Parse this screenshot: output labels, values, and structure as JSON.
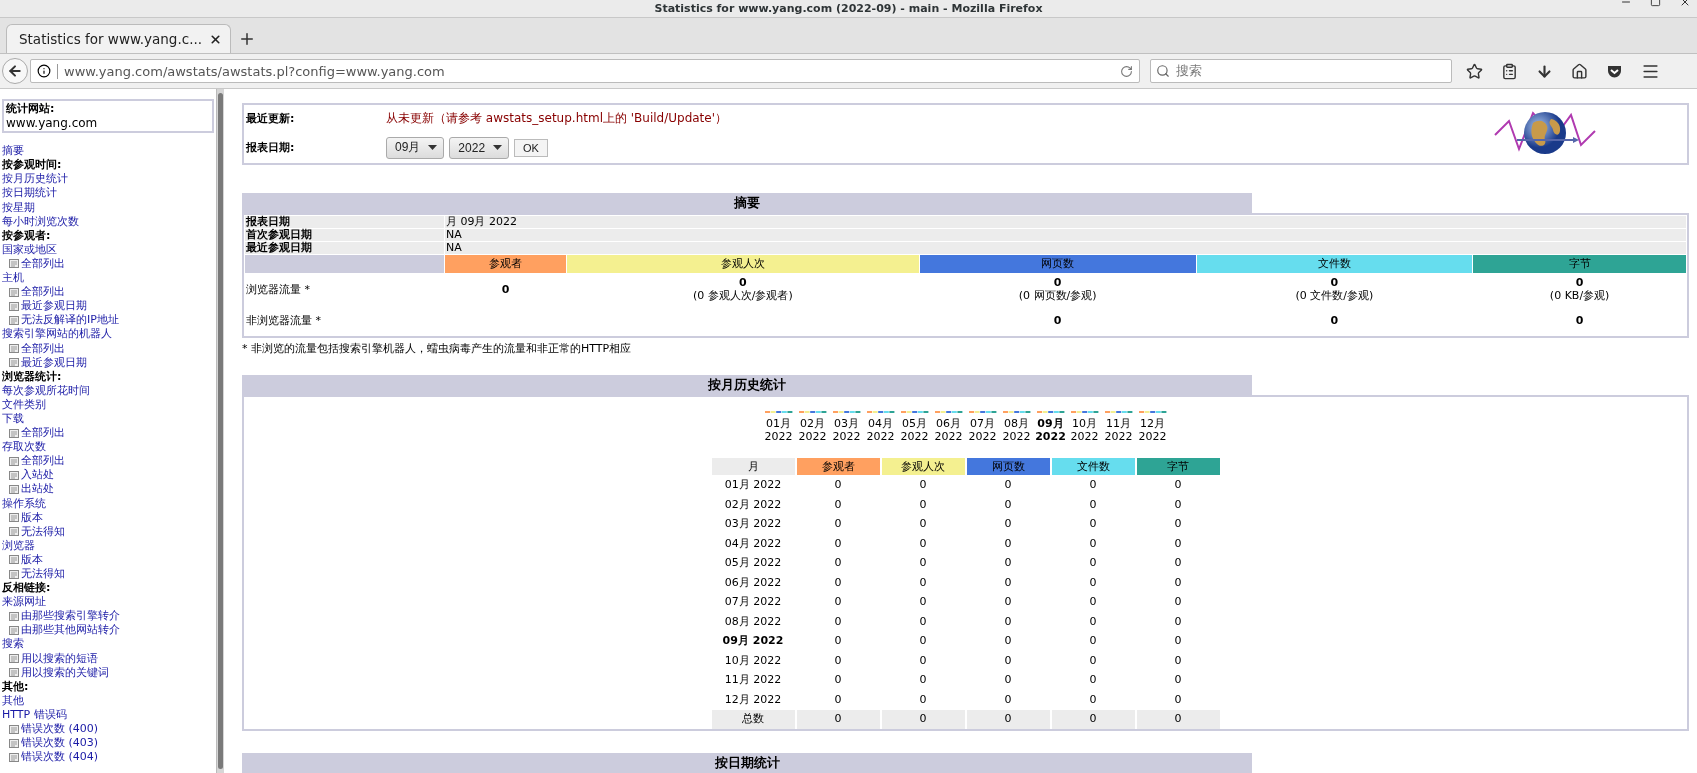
{
  "window": {
    "title": "Statistics for www.yang.com (2022-09) - main - Mozilla Firefox"
  },
  "tabs": [
    {
      "label": "Statistics for www.yang.c...",
      "selected": true
    }
  ],
  "address_bar": {
    "url": "www.yang.com/awstats/awstats.pl?config=www.yang.com"
  },
  "search": {
    "placeholder": "搜索"
  },
  "sidebar": {
    "site_label": "统计网站:",
    "site": "www.yang.com",
    "items": [
      {
        "kind": "link",
        "label": "摘要"
      },
      {
        "kind": "heading",
        "label": "按参观时间:"
      },
      {
        "kind": "link",
        "label": "按月历史统计"
      },
      {
        "kind": "link",
        "label": "按日期统计"
      },
      {
        "kind": "link",
        "label": "按星期"
      },
      {
        "kind": "link",
        "label": "每小时浏览次数"
      },
      {
        "kind": "heading",
        "label": "按参观者:"
      },
      {
        "kind": "link",
        "label": "国家或地区",
        "children": [
          {
            "label": "全部列出"
          }
        ]
      },
      {
        "kind": "link",
        "label": "主机",
        "children": [
          {
            "label": "全部列出"
          },
          {
            "label": "最近参观日期"
          },
          {
            "label": "无法反解译的IP地址"
          }
        ]
      },
      {
        "kind": "link",
        "label": "搜索引擎网站的机器人",
        "children": [
          {
            "label": "全部列出"
          },
          {
            "label": "最近参观日期"
          }
        ]
      },
      {
        "kind": "heading",
        "label": "浏览器统计:"
      },
      {
        "kind": "link",
        "label": "每次参观所花时间"
      },
      {
        "kind": "link",
        "label": "文件类别"
      },
      {
        "kind": "link",
        "label": "下载",
        "children": [
          {
            "label": "全部列出"
          }
        ]
      },
      {
        "kind": "link",
        "label": "存取次数",
        "children": [
          {
            "label": "全部列出"
          },
          {
            "label": "入站处"
          },
          {
            "label": "出站处"
          }
        ]
      },
      {
        "kind": "link",
        "label": "操作系统",
        "children": [
          {
            "label": "版本"
          },
          {
            "label": "无法得知"
          }
        ]
      },
      {
        "kind": "link",
        "label": "浏览器",
        "children": [
          {
            "label": "版本"
          },
          {
            "label": "无法得知"
          }
        ]
      },
      {
        "kind": "heading",
        "label": "反相链接:"
      },
      {
        "kind": "link",
        "label": "来源网址",
        "children": [
          {
            "label": "由那些搜索引擎转介"
          },
          {
            "label": "由那些其他网站转介"
          }
        ]
      },
      {
        "kind": "link",
        "label": "搜索",
        "children": [
          {
            "label": "用以搜索的短语"
          },
          {
            "label": "用以搜索的关键词"
          }
        ]
      },
      {
        "kind": "heading",
        "label": "其他:"
      },
      {
        "kind": "link",
        "label": "其他"
      },
      {
        "kind": "link",
        "label": "HTTP 错误码",
        "children": [
          {
            "label": "错误次数 (400)"
          },
          {
            "label": "错误次数 (403)"
          },
          {
            "label": "错误次数 (404)"
          }
        ]
      }
    ]
  },
  "header": {
    "update_label": "最近更新:",
    "update_text": "从未更新（请参考 awstats_setup.html上的 'Build/Update'）",
    "date_label": "报表日期:",
    "month": "09月",
    "year": "2022",
    "ok": "OK"
  },
  "summary": {
    "title": "摘要",
    "info_rows": [
      {
        "label": "报表日期",
        "value": "月 09月 2022"
      },
      {
        "label": "首次参观日期",
        "value": "NA"
      },
      {
        "label": "最近参观日期",
        "value": "NA"
      }
    ],
    "columns": [
      {
        "label": "参观者",
        "color": "#ffa060"
      },
      {
        "label": "参观人次",
        "color": "#f4f090"
      },
      {
        "label": "网页数",
        "color": "#4477dd"
      },
      {
        "label": "文件数",
        "color": "#66ddee"
      },
      {
        "label": "字节",
        "color": "#2ea495"
      }
    ],
    "traffic_rows": [
      {
        "label": "浏览器流量 *",
        "cells": [
          {
            "value": "0"
          },
          {
            "value": "0",
            "detail": "(0 参观人次/参观者)"
          },
          {
            "value": "0",
            "detail": "(0 网页数/参观)"
          },
          {
            "value": "0",
            "detail": "(0 文件数/参观)"
          },
          {
            "value": "0",
            "detail": "(0 KB/参观)"
          }
        ]
      },
      {
        "label": "非浏览器流量 *",
        "cells": [
          {
            "value": "0"
          },
          {
            "value": "0"
          },
          {
            "value": "0"
          }
        ]
      }
    ],
    "note": "* 非浏览的流量包括搜索引擎机器人，蠕虫病毒产生的流量和非正常的HTTP相应"
  },
  "monthly": {
    "title": "按月历史统计",
    "chart_months": [
      {
        "month": "01月",
        "year": "2022",
        "selected": false
      },
      {
        "month": "02月",
        "year": "2022",
        "selected": false
      },
      {
        "month": "03月",
        "year": "2022",
        "selected": false
      },
      {
        "month": "04月",
        "year": "2022",
        "selected": false
      },
      {
        "month": "05月",
        "year": "2022",
        "selected": false
      },
      {
        "month": "06月",
        "year": "2022",
        "selected": false
      },
      {
        "month": "07月",
        "year": "2022",
        "selected": false
      },
      {
        "month": "08月",
        "year": "2022",
        "selected": false
      },
      {
        "month": "09月",
        "year": "2022",
        "selected": true
      },
      {
        "month": "10月",
        "year": "2022",
        "selected": false
      },
      {
        "month": "11月",
        "year": "2022",
        "selected": false
      },
      {
        "month": "12月",
        "year": "2022",
        "selected": false
      }
    ],
    "month_header": "月",
    "columns": [
      {
        "label": "参观者",
        "color": "#ffa060"
      },
      {
        "label": "参观人次",
        "color": "#f4f090"
      },
      {
        "label": "网页数",
        "color": "#4477dd"
      },
      {
        "label": "文件数",
        "color": "#66ddee"
      },
      {
        "label": "字节",
        "color": "#2ea495"
      }
    ],
    "rows": [
      {
        "month": "01月 2022",
        "selected": false,
        "values": [
          "0",
          "0",
          "0",
          "0",
          "0"
        ]
      },
      {
        "month": "02月 2022",
        "selected": false,
        "values": [
          "0",
          "0",
          "0",
          "0",
          "0"
        ]
      },
      {
        "month": "03月 2022",
        "selected": false,
        "values": [
          "0",
          "0",
          "0",
          "0",
          "0"
        ]
      },
      {
        "month": "04月 2022",
        "selected": false,
        "values": [
          "0",
          "0",
          "0",
          "0",
          "0"
        ]
      },
      {
        "month": "05月 2022",
        "selected": false,
        "values": [
          "0",
          "0",
          "0",
          "0",
          "0"
        ]
      },
      {
        "month": "06月 2022",
        "selected": false,
        "values": [
          "0",
          "0",
          "0",
          "0",
          "0"
        ]
      },
      {
        "month": "07月 2022",
        "selected": false,
        "values": [
          "0",
          "0",
          "0",
          "0",
          "0"
        ]
      },
      {
        "month": "08月 2022",
        "selected": false,
        "values": [
          "0",
          "0",
          "0",
          "0",
          "0"
        ]
      },
      {
        "month": "09月 2022",
        "selected": true,
        "values": [
          "0",
          "0",
          "0",
          "0",
          "0"
        ]
      },
      {
        "month": "10月 2022",
        "selected": false,
        "values": [
          "0",
          "0",
          "0",
          "0",
          "0"
        ]
      },
      {
        "month": "11月 2022",
        "selected": false,
        "values": [
          "0",
          "0",
          "0",
          "0",
          "0"
        ]
      },
      {
        "month": "12月 2022",
        "selected": false,
        "values": [
          "0",
          "0",
          "0",
          "0",
          "0"
        ]
      }
    ],
    "total": {
      "label": "总数",
      "values": [
        "0",
        "0",
        "0",
        "0",
        "0"
      ]
    }
  },
  "next_section": {
    "title": "按日期统计"
  }
}
